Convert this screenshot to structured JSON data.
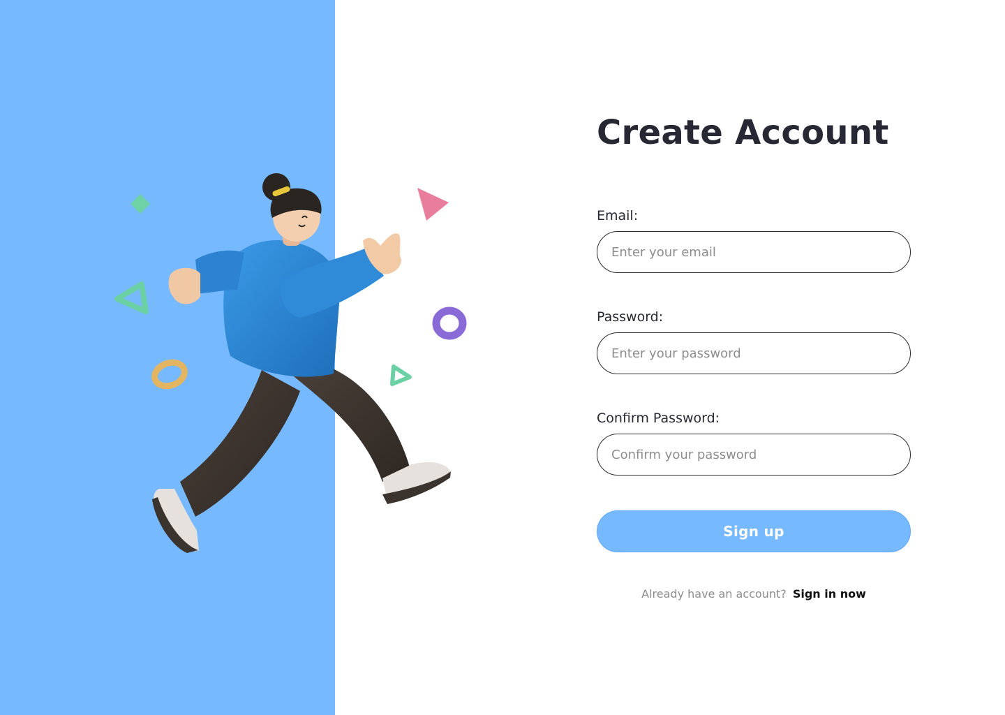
{
  "colors": {
    "panel_blue": "#77b9ff",
    "title_dark": "#272833",
    "placeholder_gray": "#8d8d8d"
  },
  "illustration": {
    "figure": "jumping-person-3d-illustration",
    "shapes": [
      "green-diamond-icon",
      "pink-triangle-icon",
      "green-triangle-outline-icon",
      "purple-torus-icon",
      "gold-ring-icon",
      "green-triangle-small-icon"
    ]
  },
  "form": {
    "title": "Create Account",
    "email": {
      "label": "Email:",
      "placeholder": "Enter your email",
      "value": ""
    },
    "password": {
      "label": "Password:",
      "placeholder": "Enter your password",
      "value": ""
    },
    "confirm_password": {
      "label": "Confirm Password:",
      "placeholder": "Confirm your password",
      "value": ""
    },
    "submit_label": "Sign up",
    "signin_prompt": "Already have an account?",
    "signin_link": "Sign in now"
  }
}
